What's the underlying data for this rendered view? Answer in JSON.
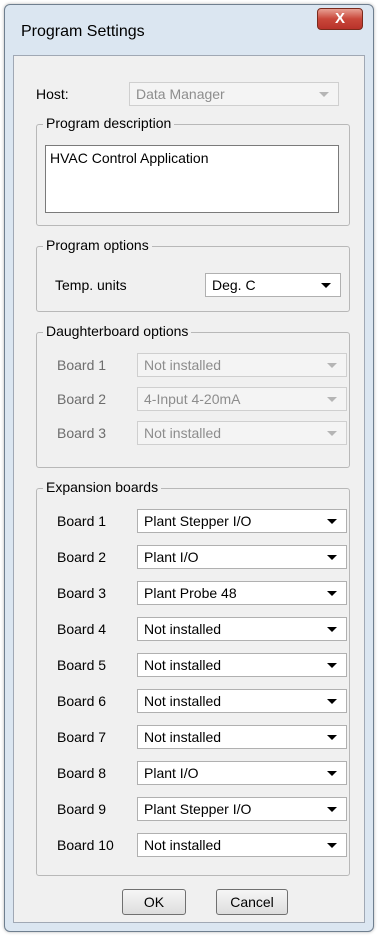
{
  "window": {
    "title": "Program Settings",
    "close_label": "X"
  },
  "host": {
    "label": "Host:",
    "value": "Data Manager"
  },
  "description": {
    "legend": "Program description",
    "value": "HVAC Control Application"
  },
  "program_options": {
    "legend": "Program options",
    "temp_label": "Temp. units",
    "temp_value": "Deg. C"
  },
  "daughterboards": {
    "legend": "Daughterboard options",
    "items": [
      {
        "label": "Board 1",
        "value": "Not installed"
      },
      {
        "label": "Board 2",
        "value": "4-Input 4-20mA"
      },
      {
        "label": "Board 3",
        "value": "Not installed"
      }
    ]
  },
  "expansion": {
    "legend": "Expansion boards",
    "items": [
      {
        "label": "Board 1",
        "value": "Plant Stepper I/O"
      },
      {
        "label": "Board 2",
        "value": "Plant I/O"
      },
      {
        "label": "Board 3",
        "value": "Plant Probe 48"
      },
      {
        "label": "Board 4",
        "value": "Not installed"
      },
      {
        "label": "Board 5",
        "value": "Not installed"
      },
      {
        "label": "Board 6",
        "value": "Not installed"
      },
      {
        "label": "Board 7",
        "value": "Not installed"
      },
      {
        "label": "Board 8",
        "value": "Plant I/O"
      },
      {
        "label": "Board 9",
        "value": "Plant Stepper I/O"
      },
      {
        "label": "Board 10",
        "value": "Not installed"
      }
    ]
  },
  "buttons": {
    "ok": "OK",
    "cancel": "Cancel"
  }
}
